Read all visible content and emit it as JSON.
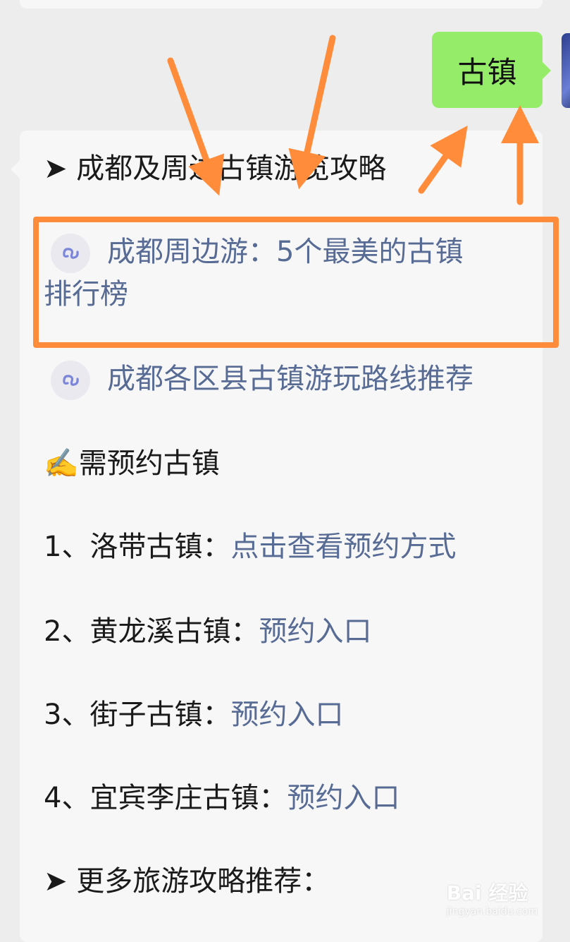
{
  "sent_message": {
    "text": "古镇"
  },
  "reply": {
    "heading": "➤ 成都及周边古镇游览攻略",
    "mini_programs": [
      {
        "line1": "成都周边游：5个最美的古镇",
        "line2": "排行榜"
      },
      {
        "line1": "成都各区县古镇游玩路线推荐"
      }
    ],
    "reserve_heading": "✍️需预约古镇",
    "towns": [
      {
        "label": "1、洛带古镇：",
        "link": "点击查看预约方式"
      },
      {
        "label": "2、黄龙溪古镇：",
        "link": "预约入口"
      },
      {
        "label": "3、街子古镇：",
        "link": "预约入口"
      },
      {
        "label": "4、宜宾李庄古镇：",
        "link": "预约入口"
      }
    ],
    "more_heading": "➤ 更多旅游攻略推荐："
  },
  "watermark": {
    "main": "Bai 经验",
    "sub": "jingyan.baidu.com"
  },
  "colors": {
    "link": "#576b95",
    "sent_bubble": "#95ec69",
    "annotation": "#ff8c3a"
  },
  "icons": [
    "mini-program-link-icon",
    "avatar"
  ]
}
